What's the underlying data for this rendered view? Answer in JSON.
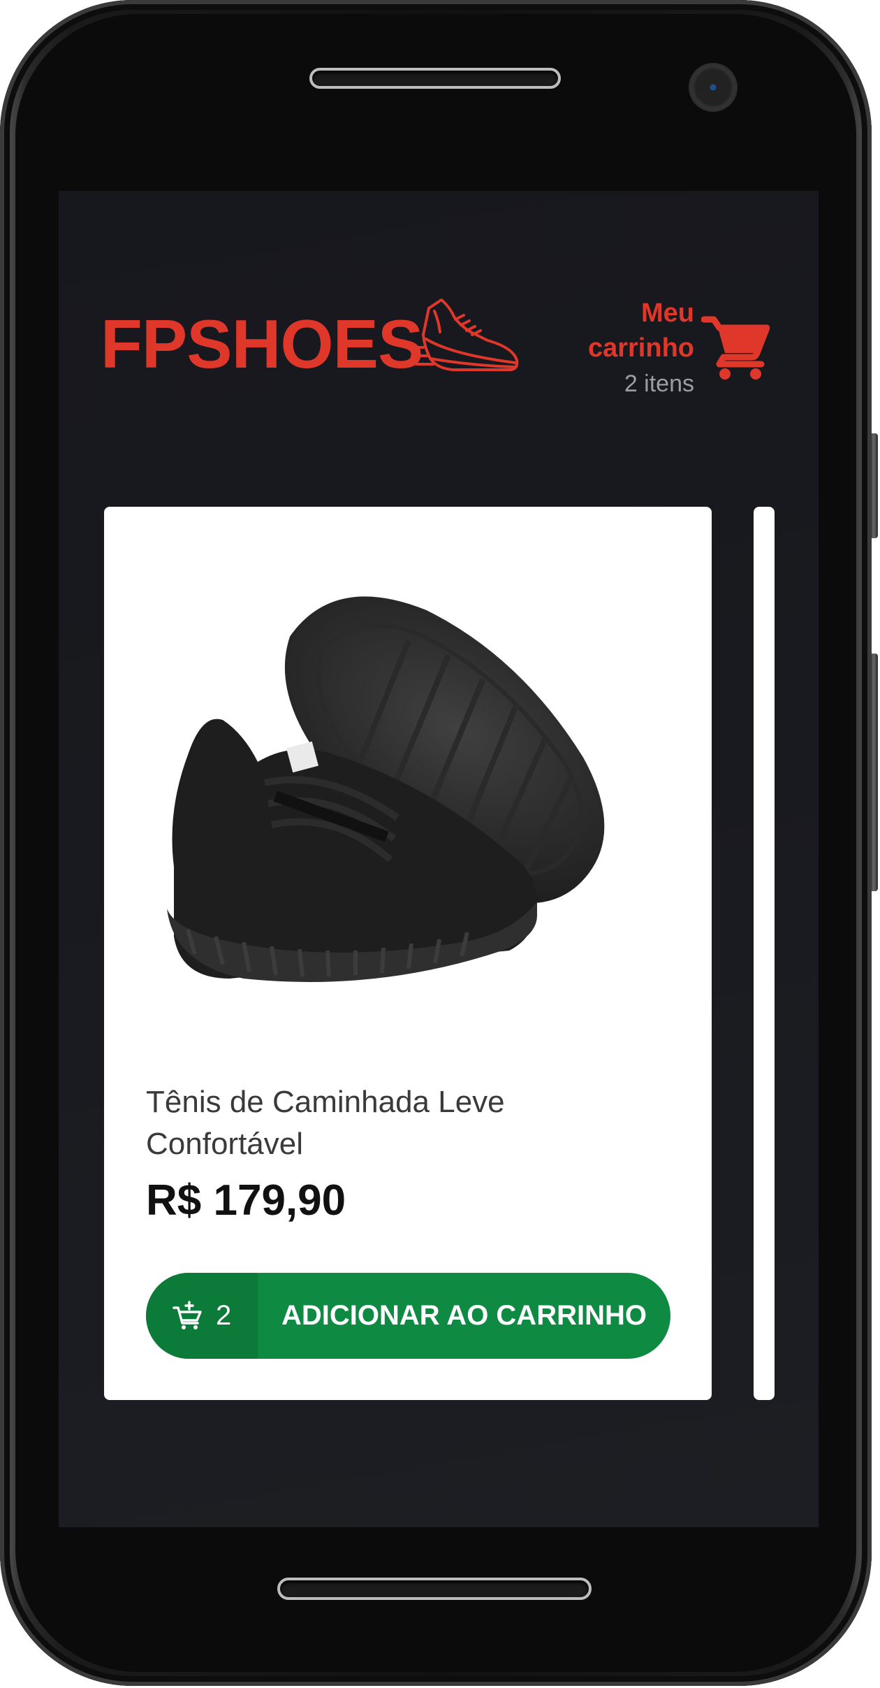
{
  "brand": {
    "name": "FPSHOES",
    "color": "#e0372b"
  },
  "cart": {
    "title": "Meu carrinho",
    "count_label": "2 itens"
  },
  "products": [
    {
      "title": "Tênis de Caminhada Leve Confortável",
      "price": "R$ 179,90",
      "quantity_in_cart": "2",
      "add_button_label": "ADICIONAR AO CARRINHO"
    }
  ],
  "colors": {
    "background": "#17181d",
    "button": "#0f8a42",
    "button_qty": "#0c7a39",
    "cart_count": "#9d9da3"
  },
  "icons": {
    "logo": "running-shoe-icon",
    "cart": "shopping-cart-icon",
    "add_to_cart": "cart-plus-icon"
  }
}
